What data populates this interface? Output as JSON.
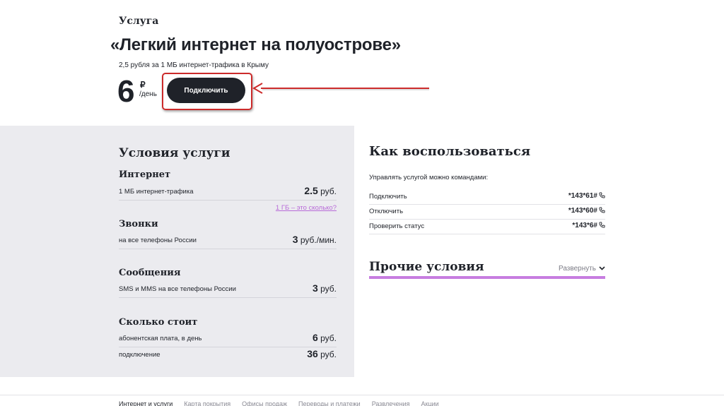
{
  "header": {
    "eyebrow": "Услуга",
    "title": "«Легкий интернет на полуострове»",
    "subtitle": "2,5 рубля за 1 МБ интернет-трафика в Крыму",
    "price": "6",
    "currency": "₽",
    "per": "/день",
    "connect_label": "Подключить"
  },
  "conditions": {
    "title": "Условия услуги",
    "internet": {
      "title": "Интернет",
      "row_label": "1 МБ интернет-трафика",
      "row_amount": "2.5",
      "row_unit": " руб.",
      "link": "1 ГБ – это сколько?"
    },
    "calls": {
      "title": "Звонки",
      "row_label": "на все телефоны России",
      "row_amount": "3",
      "row_unit": " руб./мин."
    },
    "messages": {
      "title": "Сообщения",
      "row_label": "SMS и MMS на все телефоны России",
      "row_amount": "3",
      "row_unit": " руб."
    },
    "cost": {
      "title": "Сколько стоит",
      "rows": [
        {
          "label": "абонентская плата, в день",
          "amount": "6",
          "unit": " руб."
        },
        {
          "label": "подключение",
          "amount": "36",
          "unit": " руб."
        }
      ]
    }
  },
  "how": {
    "title": "Как воспользоваться",
    "subtitle": "Управлять услугой можно командами:",
    "commands": [
      {
        "label": "Подключить",
        "code": "*143*61#"
      },
      {
        "label": "Отключить",
        "code": "*143*60#"
      },
      {
        "label": "Проверить статус",
        "code": "*143*6#"
      }
    ]
  },
  "other": {
    "title": "Прочие условия",
    "expand_label": "Развернуть"
  },
  "footer": {
    "items": [
      "Интернет и услуги",
      "Карта покрытия",
      "Офисы продаж",
      "Переводы и платежи",
      "Развлечения",
      "Акции"
    ]
  },
  "colors": {
    "accent": "#c77de0",
    "highlight_frame": "#cc2b2b",
    "button": "#1f2229",
    "panel": "#ebebef"
  },
  "icons": {
    "phone": "phone-icon",
    "chevron": "chevron-down-icon"
  }
}
